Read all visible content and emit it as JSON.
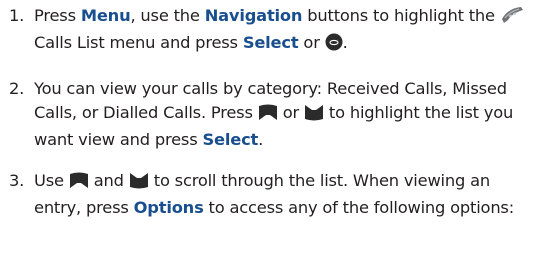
{
  "colors": {
    "text": "#231f20",
    "keyword": "#1a4f8f",
    "softkey_icon": "#2b2b2b"
  },
  "steps": [
    {
      "number": "1.",
      "parts": {
        "a": "Press ",
        "menu": "Menu",
        "b": ", use the ",
        "navigation": "Navigation",
        "c": " buttons to highlight the ",
        "d": " Calls List menu and press ",
        "select": "Select",
        "e": " or ",
        "f": "."
      },
      "icons": [
        "calls-list-phone-icon",
        "ok-button-icon"
      ]
    },
    {
      "number": "2.",
      "parts": {
        "a": "You can view your calls by category: Received Calls, Missed Calls, or Dialled Calls. Press ",
        "b": " or ",
        "c": " to highlight the list you want view and press ",
        "select": "Select",
        "d": "."
      },
      "icons": [
        "up-key-icon",
        "down-key-icon"
      ]
    },
    {
      "number": "3.",
      "parts": {
        "a": "Use ",
        "b": " and ",
        "c": " to scroll through the list. When viewing an entry, press ",
        "options": "Options",
        "d": " to access any of the following options:"
      },
      "icons": [
        "up-key-icon",
        "down-key-icon"
      ]
    }
  ]
}
